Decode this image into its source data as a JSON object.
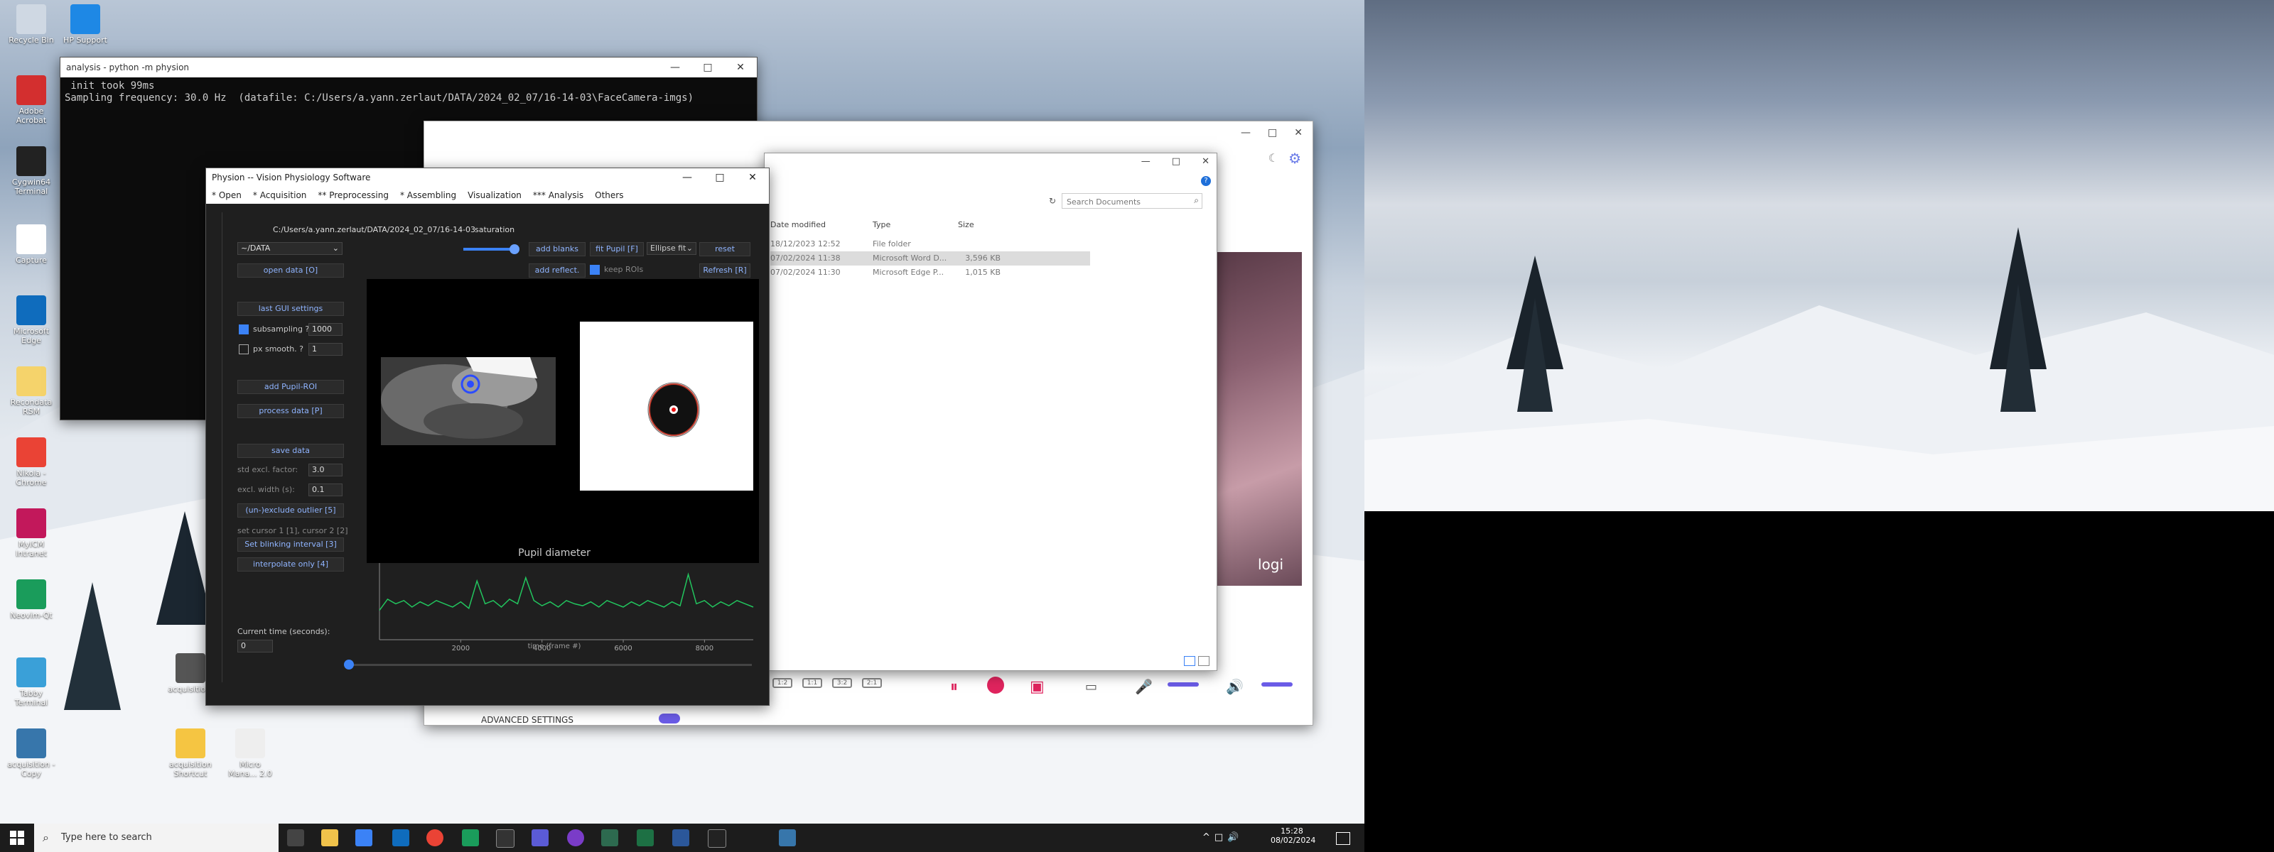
{
  "desktop": {
    "icons": [
      {
        "label": "Recycle Bin",
        "icon": "recycle-bin-icon"
      },
      {
        "label": "HP Support",
        "icon": "hp-support-icon"
      },
      {
        "label": "Adobe Acrobat",
        "icon": "acrobat-icon"
      },
      {
        "label": "Cygwin64 Terminal",
        "icon": "cygwin-icon"
      },
      {
        "label": "Capture",
        "icon": "capture-icon"
      },
      {
        "label": "Microsoft Edge",
        "icon": "edge-icon"
      },
      {
        "label": "Recondata RSM",
        "icon": "document-icon"
      },
      {
        "label": "Nikola - Chrome",
        "icon": "chrome-icon"
      },
      {
        "label": "MyICM Intranet",
        "icon": "myicm-icon"
      },
      {
        "label": "Neovim-Qt",
        "icon": "neovim-icon"
      },
      {
        "label": "Tabby Terminal",
        "icon": "tabby-icon"
      },
      {
        "label": "acquisition - Copy",
        "icon": "python-icon"
      },
      {
        "label": "acquisitio...",
        "icon": "camera-icon"
      },
      {
        "label": "acquisition Shortcut",
        "icon": "folder-icon"
      },
      {
        "label": "Micro Mana... 2.0",
        "icon": "microscope-icon"
      }
    ]
  },
  "terminal": {
    "title": "analysis - python -m physion",
    "lines": [
      " init took 99ms",
      "Sampling frequency: 30.0 Hz  (datafile: C:/Users/a.yann.zerlaut/DATA/2024_02_07/16-14-03\\FaceCamera-imgs)"
    ]
  },
  "explorer": {
    "search_placeholder": "Search Documents",
    "columns": [
      "Date modified",
      "Type",
      "Size"
    ],
    "rows": [
      {
        "date": "18/12/2023 12:52",
        "type": "File folder",
        "size": ""
      },
      {
        "date": "07/02/2024 11:38",
        "type": "Microsoft Word D...",
        "size": "3,596 KB"
      },
      {
        "date": "07/02/2024 11:30",
        "type": "Microsoft Edge P...",
        "size": "1,015 KB"
      }
    ]
  },
  "logi": {
    "brand": "logi",
    "advanced_label": "ADVANCED SETTINGS",
    "layout_buttons": [
      "1:2",
      "1:1",
      "3:2",
      "2:1"
    ]
  },
  "physion": {
    "title": "Physion -- Vision Physiology Software",
    "menu": [
      "* Open",
      "* Acquisition",
      "** Preprocessing",
      "* Assembling",
      "Visualization",
      "*** Analysis",
      "Others"
    ],
    "path": "C:/Users/a.yann.zerlaut/DATA/2024_02_07/16-14-03",
    "saturation_label": "saturation",
    "saturation_level": 0.92,
    "folder_select": "~/DATA",
    "open_data": "open data [O]",
    "last_gui": "last GUI settings",
    "subsampling_label": "subsampling ?",
    "subsampling_value": "1000",
    "pxsmooth_label": "px smooth. ?",
    "pxsmooth_value": "1",
    "add_roi": "add Pupil-ROI",
    "process": "process data [P]",
    "save": "save data",
    "std_label": "std excl. factor:",
    "std_value": "3.0",
    "excl_label": "excl. width (s):",
    "excl_value": "0.1",
    "unexclude": "(un-)exclude outlier [5]",
    "cursor_label": "set cursor 1 [1], cursor 2 [2]",
    "blink": "Set blinking interval [3]",
    "interp": "interpolate only [4]",
    "current_time_label": "Current time (seconds):",
    "current_time_value": "0",
    "add_blanks": "add blanks",
    "fit_pupil": "fit Pupil [F]",
    "fit_select": "Ellipse fit",
    "reset": "reset",
    "add_reflect": "add reflect.",
    "keep_rois": "keep ROIs",
    "refresh": "Refresh [R]",
    "chart_title": "Pupil diameter",
    "xlabel": "time (frame #)",
    "xticks": [
      "2000",
      "4000",
      "6000",
      "8000"
    ]
  },
  "chart_data": {
    "type": "line",
    "title": "Pupil diameter",
    "xlabel": "time (frame #)",
    "ylabel": "",
    "xlim": [
      0,
      9200
    ],
    "xticks": [
      2000,
      4000,
      6000,
      8000
    ],
    "grid": false,
    "series": [
      {
        "color": "#22c55e",
        "x": [
          0,
          200,
          400,
          600,
          800,
          1000,
          1200,
          1400,
          1600,
          1800,
          2000,
          2200,
          2400,
          2600,
          2800,
          3000,
          3200,
          3400,
          3600,
          3800,
          4000,
          4200,
          4400,
          4600,
          4800,
          5000,
          5200,
          5400,
          5600,
          5800,
          6000,
          6200,
          6400,
          6600,
          6800,
          7000,
          7200,
          7400,
          7600,
          7800,
          8000,
          8200,
          8400,
          8600,
          8800,
          9000,
          9200
        ],
        "y": [
          0.45,
          0.62,
          0.55,
          0.6,
          0.5,
          0.58,
          0.52,
          0.6,
          0.55,
          0.5,
          0.58,
          0.48,
          0.9,
          0.55,
          0.6,
          0.5,
          0.62,
          0.55,
          0.95,
          0.6,
          0.52,
          0.58,
          0.5,
          0.6,
          0.55,
          0.52,
          0.58,
          0.5,
          0.6,
          0.55,
          0.5,
          0.58,
          0.52,
          0.6,
          0.55,
          0.5,
          0.58,
          0.52,
          1.0,
          0.55,
          0.6,
          0.5,
          0.58,
          0.52,
          0.6,
          0.55,
          0.5
        ]
      }
    ]
  },
  "taskbar": {
    "search_placeholder": "Type here to search",
    "time": "15:28",
    "date": "08/02/2024"
  }
}
